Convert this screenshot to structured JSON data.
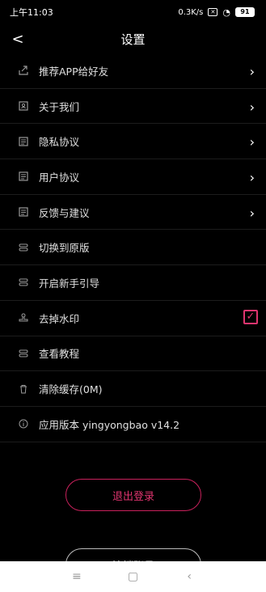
{
  "status": {
    "time": "上午11:03",
    "net": "0.3K/s",
    "battery": "91"
  },
  "header": {
    "title": "设置"
  },
  "settings": [
    {
      "icon": "share-icon",
      "label": "推荐APP给好友",
      "arrow": true
    },
    {
      "icon": "contact-card-icon",
      "label": "关于我们",
      "arrow": true
    },
    {
      "icon": "document-icon",
      "label": "隐私协议",
      "arrow": true
    },
    {
      "icon": "document-icon",
      "label": "用户协议",
      "arrow": true
    },
    {
      "icon": "document-icon",
      "label": "反馈与建议",
      "arrow": true
    },
    {
      "icon": "switch-icon",
      "label": "切换到原版",
      "arrow": false
    },
    {
      "icon": "switch-icon",
      "label": "开启新手引导",
      "arrow": false
    },
    {
      "icon": "stamp-icon",
      "label": "去掉水印",
      "arrow": false,
      "checked": true
    },
    {
      "icon": "switch-icon",
      "label": "查看教程",
      "arrow": false
    },
    {
      "icon": "trash-icon",
      "label": "清除缓存(0M)",
      "arrow": false
    },
    {
      "icon": "info-icon",
      "label": "应用版本 yingyongbao v14.2",
      "arrow": false
    }
  ],
  "buttons": {
    "logout": "退出登录",
    "delete_account": "注销账号"
  },
  "colors": {
    "accent": "#e0356f"
  }
}
